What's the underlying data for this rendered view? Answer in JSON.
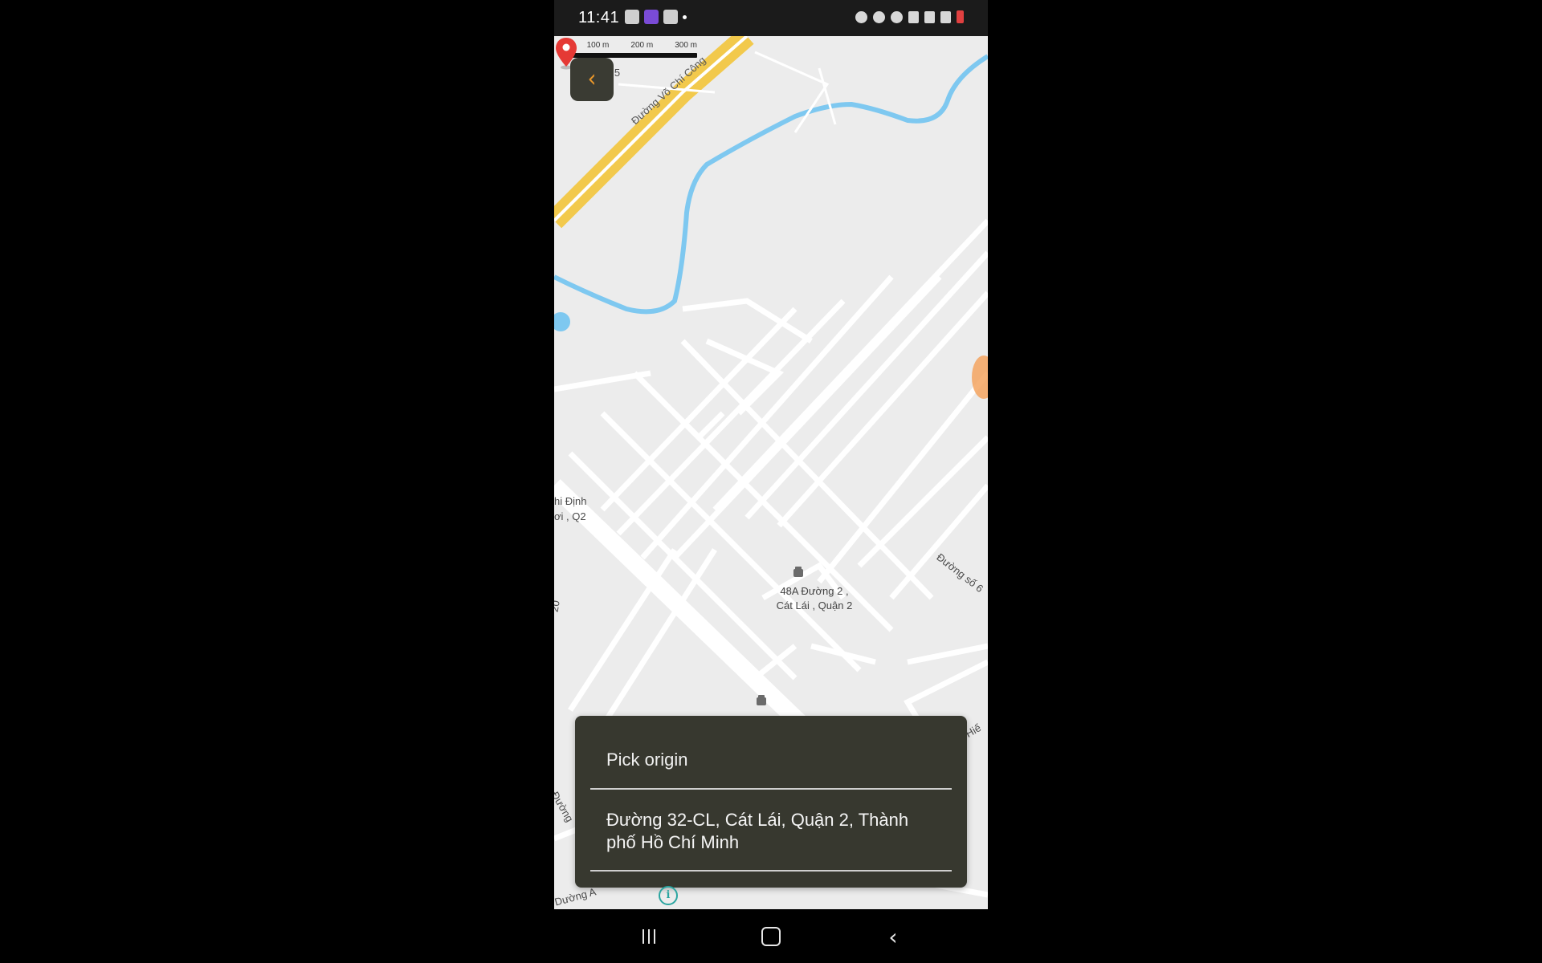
{
  "status_bar": {
    "time": "11:41",
    "left_icons": [
      "qr-code-icon",
      "gallery-icon",
      "cards-icon",
      "notification-dot-icon"
    ],
    "right_icons": [
      "alarm-icon",
      "location-icon",
      "hotspot-icon",
      "volte-icon",
      "4g-icon",
      "signal-icon",
      "battery-icon"
    ]
  },
  "map": {
    "scale_labels": [
      "0",
      "100 m",
      "200 m",
      "300 m"
    ],
    "road_labels": {
      "vo_chi_cong": "Đường Võ Chí Công",
      "top_left_fragment": "ố 5",
      "right_fragment": "Đường số 6",
      "left_fragment_1": "hi Định",
      "left_fragment_2": "ơi , Q2",
      "bottom_right_fragment": "Hiế",
      "bottom_left_fragment": "Đường",
      "bottom_corner_fragment": "Dường A",
      "left_vertical_fragment": "20"
    },
    "pois": [
      {
        "line1": "48A Đường 2 ,",
        "line2": "Cát Lái , Quận 2"
      }
    ],
    "colors": {
      "background": "#ececec",
      "road": "#ffffff",
      "highway": "#f2c94c",
      "water": "#7ec8f0",
      "pin": "#e53935",
      "sheet": "#37382f",
      "accent": "#e8962a"
    }
  },
  "back_button": {
    "icon": "chevron-left-icon"
  },
  "bottom_sheet": {
    "title": "Pick origin",
    "address": "Đường 32-CL, Cát Lái, Quận 2, Thành phố Hồ Chí Minh"
  },
  "nav_bar": {
    "buttons": [
      "recents-icon",
      "home-icon",
      "back-icon"
    ]
  }
}
